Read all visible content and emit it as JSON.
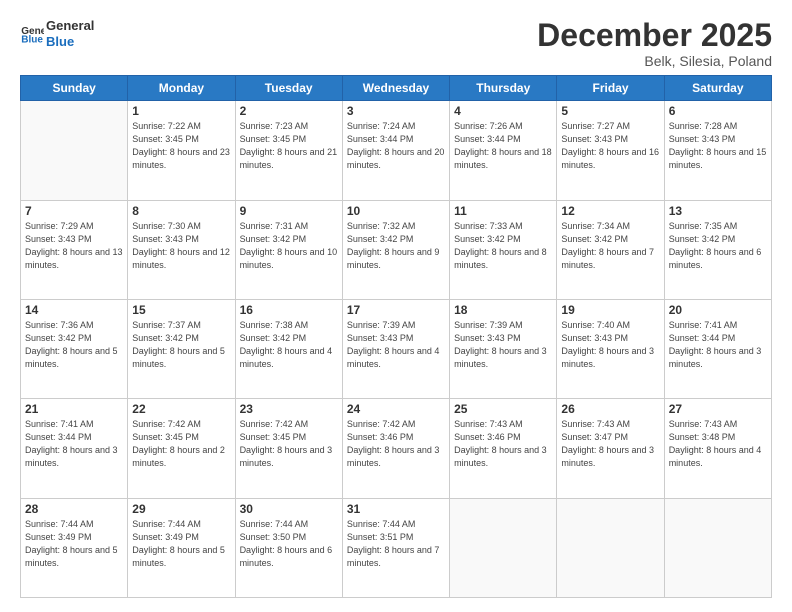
{
  "logo": {
    "line1": "General",
    "line2": "Blue"
  },
  "title": "December 2025",
  "location": "Belk, Silesia, Poland",
  "days_of_week": [
    "Sunday",
    "Monday",
    "Tuesday",
    "Wednesday",
    "Thursday",
    "Friday",
    "Saturday"
  ],
  "weeks": [
    [
      {
        "day": null
      },
      {
        "day": "1",
        "sunrise": "7:22 AM",
        "sunset": "3:45 PM",
        "daylight": "8 hours and 23 minutes."
      },
      {
        "day": "2",
        "sunrise": "7:23 AM",
        "sunset": "3:45 PM",
        "daylight": "8 hours and 21 minutes."
      },
      {
        "day": "3",
        "sunrise": "7:24 AM",
        "sunset": "3:44 PM",
        "daylight": "8 hours and 20 minutes."
      },
      {
        "day": "4",
        "sunrise": "7:26 AM",
        "sunset": "3:44 PM",
        "daylight": "8 hours and 18 minutes."
      },
      {
        "day": "5",
        "sunrise": "7:27 AM",
        "sunset": "3:43 PM",
        "daylight": "8 hours and 16 minutes."
      },
      {
        "day": "6",
        "sunrise": "7:28 AM",
        "sunset": "3:43 PM",
        "daylight": "8 hours and 15 minutes."
      }
    ],
    [
      {
        "day": "7",
        "sunrise": "7:29 AM",
        "sunset": "3:43 PM",
        "daylight": "8 hours and 13 minutes."
      },
      {
        "day": "8",
        "sunrise": "7:30 AM",
        "sunset": "3:43 PM",
        "daylight": "8 hours and 12 minutes."
      },
      {
        "day": "9",
        "sunrise": "7:31 AM",
        "sunset": "3:42 PM",
        "daylight": "8 hours and 10 minutes."
      },
      {
        "day": "10",
        "sunrise": "7:32 AM",
        "sunset": "3:42 PM",
        "daylight": "8 hours and 9 minutes."
      },
      {
        "day": "11",
        "sunrise": "7:33 AM",
        "sunset": "3:42 PM",
        "daylight": "8 hours and 8 minutes."
      },
      {
        "day": "12",
        "sunrise": "7:34 AM",
        "sunset": "3:42 PM",
        "daylight": "8 hours and 7 minutes."
      },
      {
        "day": "13",
        "sunrise": "7:35 AM",
        "sunset": "3:42 PM",
        "daylight": "8 hours and 6 minutes."
      }
    ],
    [
      {
        "day": "14",
        "sunrise": "7:36 AM",
        "sunset": "3:42 PM",
        "daylight": "8 hours and 5 minutes."
      },
      {
        "day": "15",
        "sunrise": "7:37 AM",
        "sunset": "3:42 PM",
        "daylight": "8 hours and 5 minutes."
      },
      {
        "day": "16",
        "sunrise": "7:38 AM",
        "sunset": "3:42 PM",
        "daylight": "8 hours and 4 minutes."
      },
      {
        "day": "17",
        "sunrise": "7:39 AM",
        "sunset": "3:43 PM",
        "daylight": "8 hours and 4 minutes."
      },
      {
        "day": "18",
        "sunrise": "7:39 AM",
        "sunset": "3:43 PM",
        "daylight": "8 hours and 3 minutes."
      },
      {
        "day": "19",
        "sunrise": "7:40 AM",
        "sunset": "3:43 PM",
        "daylight": "8 hours and 3 minutes."
      },
      {
        "day": "20",
        "sunrise": "7:41 AM",
        "sunset": "3:44 PM",
        "daylight": "8 hours and 3 minutes."
      }
    ],
    [
      {
        "day": "21",
        "sunrise": "7:41 AM",
        "sunset": "3:44 PM",
        "daylight": "8 hours and 3 minutes."
      },
      {
        "day": "22",
        "sunrise": "7:42 AM",
        "sunset": "3:45 PM",
        "daylight": "8 hours and 2 minutes."
      },
      {
        "day": "23",
        "sunrise": "7:42 AM",
        "sunset": "3:45 PM",
        "daylight": "8 hours and 3 minutes."
      },
      {
        "day": "24",
        "sunrise": "7:42 AM",
        "sunset": "3:46 PM",
        "daylight": "8 hours and 3 minutes."
      },
      {
        "day": "25",
        "sunrise": "7:43 AM",
        "sunset": "3:46 PM",
        "daylight": "8 hours and 3 minutes."
      },
      {
        "day": "26",
        "sunrise": "7:43 AM",
        "sunset": "3:47 PM",
        "daylight": "8 hours and 3 minutes."
      },
      {
        "day": "27",
        "sunrise": "7:43 AM",
        "sunset": "3:48 PM",
        "daylight": "8 hours and 4 minutes."
      }
    ],
    [
      {
        "day": "28",
        "sunrise": "7:44 AM",
        "sunset": "3:49 PM",
        "daylight": "8 hours and 5 minutes."
      },
      {
        "day": "29",
        "sunrise": "7:44 AM",
        "sunset": "3:49 PM",
        "daylight": "8 hours and 5 minutes."
      },
      {
        "day": "30",
        "sunrise": "7:44 AM",
        "sunset": "3:50 PM",
        "daylight": "8 hours and 6 minutes."
      },
      {
        "day": "31",
        "sunrise": "7:44 AM",
        "sunset": "3:51 PM",
        "daylight": "8 hours and 7 minutes."
      },
      {
        "day": null
      },
      {
        "day": null
      },
      {
        "day": null
      }
    ]
  ]
}
